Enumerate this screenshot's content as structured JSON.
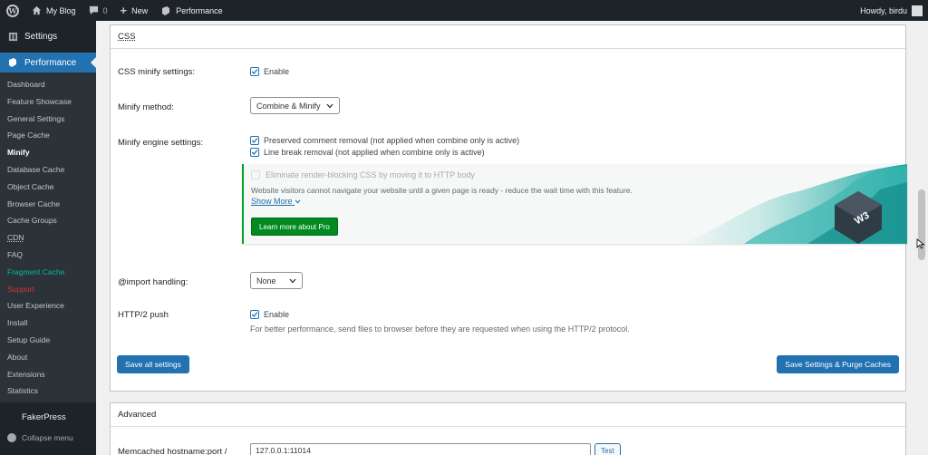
{
  "adminbar": {
    "wp_logo_icon": "wordpress-logo-icon",
    "site_name": "My Blog",
    "comments_count": "0",
    "new_label": "New",
    "performance_label": "Performance",
    "howdy": "Howdy, birdu"
  },
  "sidebar": {
    "settings_label": "Settings",
    "performance_label": "Performance",
    "items": [
      {
        "label": "Dashboard"
      },
      {
        "label": "Feature Showcase"
      },
      {
        "label": "General Settings"
      },
      {
        "label": "Page Cache"
      },
      {
        "label": "Minify"
      },
      {
        "label": "Database Cache"
      },
      {
        "label": "Object Cache"
      },
      {
        "label": "Browser Cache"
      },
      {
        "label": "Cache Groups"
      },
      {
        "label": "CDN"
      },
      {
        "label": "FAQ"
      },
      {
        "label": "Fragment Cache"
      },
      {
        "label": "Support"
      },
      {
        "label": "User Experience"
      },
      {
        "label": "Install"
      },
      {
        "label": "Setup Guide"
      },
      {
        "label": "About"
      },
      {
        "label": "Extensions"
      },
      {
        "label": "Statistics"
      }
    ],
    "fakerpress": "FakerPress",
    "collapse": "Collapse menu"
  },
  "css_panel": {
    "heading": "CSS",
    "minify_settings_label": "CSS minify settings:",
    "enable_label": "Enable",
    "minify_method_label": "Minify method:",
    "minify_method_value": "Combine & Minify",
    "engine_label": "Minify engine settings:",
    "preserved_comment": "Preserved comment removal (not applied when combine only is active)",
    "line_break": "Line break removal (not applied when combine only is active)",
    "promo": {
      "title": "Eliminate render-blocking CSS by moving it to HTTP body",
      "description": "Website visitors cannot navigate your website until a given page is ready - reduce the wait time with this feature.",
      "show_more": "Show More",
      "button": "Learn more about Pro",
      "badge": "W3"
    },
    "import_label": "@import handling:",
    "import_value": "None",
    "http2_label": "HTTP/2 push",
    "http2_enable": "Enable",
    "http2_desc": "For better performance, send files to browser before they are requested when using the HTTP/2 protocol.",
    "save_all": "Save all settings",
    "save_purge": "Save Settings & Purge Caches"
  },
  "advanced_panel": {
    "heading": "Advanced",
    "memcached_label": "Memcached hostname:port /",
    "memcached_value": "127.0.0.1:11014",
    "test_button": "Test"
  },
  "colors": {
    "accent": "#2271b1",
    "sidebar_bg": "#1d2327",
    "pro_button": "#008a20",
    "fragment_cache": "#00b9a0",
    "support": "#d63638"
  }
}
